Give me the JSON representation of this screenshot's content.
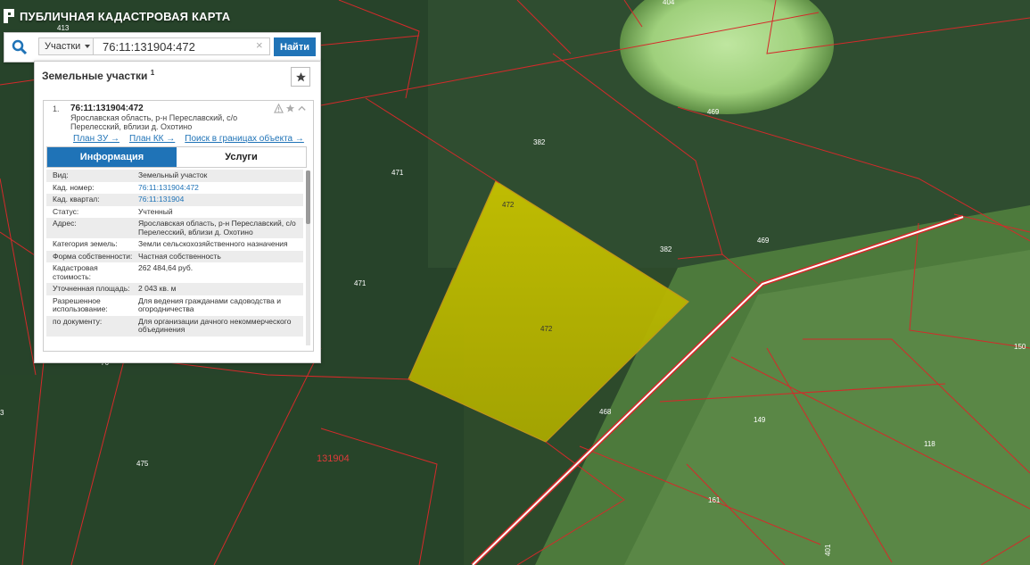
{
  "app": {
    "title": "ПУБЛИЧНАЯ КАДАСТРОВАЯ КАРТА"
  },
  "search": {
    "category": "Участки",
    "value": "76:11:131904:472",
    "find_label": "Найти",
    "clear": "×"
  },
  "panel": {
    "header": "Земельные участки",
    "count": "1",
    "result": {
      "index": "1.",
      "cad_number": "76:11:131904:472",
      "address": "Ярославская область, р-н Переславский, с/о Перелесский, вблизи д. Охотино",
      "links": [
        "План ЗУ →",
        "План КК →",
        "Поиск в границах объекта →"
      ]
    },
    "tabs": [
      {
        "label": "Информация",
        "active": true
      },
      {
        "label": "Услуги",
        "active": false
      }
    ],
    "rows": [
      {
        "k": "Вид:",
        "v": "Земельный участок"
      },
      {
        "k": "Кад. номер:",
        "v": "76:11:131904:472",
        "link": true
      },
      {
        "k": "Кад. квартал:",
        "v": "76:11:131904",
        "link": true
      },
      {
        "k": "Статус:",
        "v": "Учтенный"
      },
      {
        "k": "Адрес:",
        "v": "Ярославская область, р-н Переславский, с/о Перелесский, вблизи д. Охотино"
      },
      {
        "k": "Категория земель:",
        "v": "Земли сельскохозяйственного назначения"
      },
      {
        "k": "Форма собственности:",
        "v": "Частная собственность"
      },
      {
        "k": "Кадастровая стоимость:",
        "v": "262 484,64 руб."
      },
      {
        "k": "Уточненная площадь:",
        "v": "2 043 кв. м"
      },
      {
        "k": "Разрешенное использование:",
        "v": "Для ведения гражданами садоводства и огородничества"
      },
      {
        "k": "по документу:",
        "v": "Для организации дачного некоммерческого объединения"
      }
    ]
  },
  "map": {
    "quarter_label": "131904",
    "labels": [
      "413",
      "404",
      "469",
      "382",
      "471",
      "472",
      "472",
      "382",
      "469",
      "471",
      "150",
      "468",
      "149",
      "118",
      "475",
      "161",
      "3",
      "76",
      "401"
    ]
  },
  "colors": {
    "accent": "#1f73b7",
    "parcel_fill": "#b7b800",
    "boundary": "#d42a2a"
  }
}
